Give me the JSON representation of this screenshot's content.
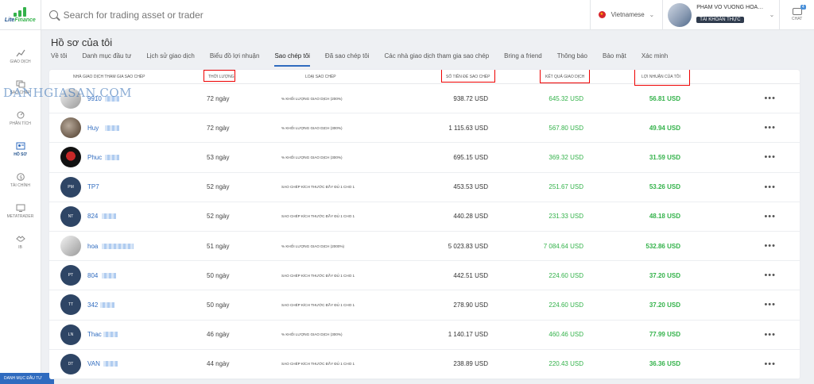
{
  "app": {
    "logo_text_1": "Lite",
    "logo_text_2": "Finance"
  },
  "search": {
    "placeholder": "Search for trading asset or trader"
  },
  "language": {
    "label": "Vietnamese"
  },
  "user": {
    "name": "PHAM VO VUONG HOA…",
    "account_type": "TÀI KHOẢN THỰC"
  },
  "chat": {
    "label": "CHAT",
    "count": "4"
  },
  "sidebar": {
    "items": [
      {
        "label": "GIAO DỊCH",
        "icon": "chart-line-icon"
      },
      {
        "label": "SAO CHÉP",
        "icon": "copy-icon"
      },
      {
        "label": "PHÂN TÍCH",
        "icon": "analytics-icon"
      },
      {
        "label": "HỒ SƠ",
        "icon": "profile-icon"
      },
      {
        "label": "TÀI CHÍNH",
        "icon": "dollar-icon"
      },
      {
        "label": "METATRADER",
        "icon": "monitor-icon"
      },
      {
        "label": "IB",
        "icon": "handshake-icon"
      }
    ],
    "bottom_label": "DANH MỤC ĐẦU TƯ",
    "active_index": 3
  },
  "page": {
    "title": "Hồ sơ của tôi"
  },
  "tabs": [
    "Về tôi",
    "Danh mục đầu tư",
    "Lịch sử giao dịch",
    "Biểu đồ lợi nhuận",
    "Sao chép tôi",
    "Đã sao chép tôi",
    "Các nhà giao dịch tham gia sao chép",
    "Bring a friend",
    "Thông báo",
    "Bảo mật",
    "Xác minh"
  ],
  "active_tab": 4,
  "table": {
    "headers": {
      "trader": "NHÀ GIAO DỊCH THAM GIA SAO CHÉP",
      "duration": "THỜI LƯỢNG",
      "copy_type": "LOẠI SAO CHÉP",
      "amount": "SỐ TIỀN ĐỂ SAO CHÉP",
      "result": "KẾT QUẢ GIAO DỊCH",
      "profit": "LỢI NHUẬN CỦA TÔI"
    },
    "rows": [
      {
        "avatar": "",
        "trader": "9910",
        "duration": "72 ngày",
        "copy_type": "% KHỐI LƯỢNG GIAO DỊCH (200%)",
        "amount": "938.72 USD",
        "result": "645.32 USD",
        "profit": "56.81 USD"
      },
      {
        "avatar": "",
        "trader": "Huy",
        "duration": "72 ngày",
        "copy_type": "% KHỐI LƯỢNG GIAO DỊCH (300%)",
        "amount": "1 115.63 USD",
        "result": "567.80 USD",
        "profit": "49.94 USD"
      },
      {
        "avatar": "",
        "trader": "Phuc",
        "duration": "53 ngày",
        "copy_type": "% KHỐI LƯỢNG GIAO DỊCH (300%)",
        "amount": "695.15 USD",
        "result": "369.32 USD",
        "profit": "31.59 USD"
      },
      {
        "avatar": "PM",
        "trader": "TP7",
        "duration": "52 ngày",
        "copy_type": "SAO CHÉP KÍCH THƯỚC ĐẦY ĐỦ 1 CHO 1",
        "amount": "453.53 USD",
        "result": "251.67 USD",
        "profit": "53.26 USD"
      },
      {
        "avatar": "NT",
        "trader": "824",
        "duration": "52 ngày",
        "copy_type": "SAO CHÉP KÍCH THƯỚC ĐẦY ĐỦ 1 CHO 1",
        "amount": "440.28 USD",
        "result": "231.33 USD",
        "profit": "48.18 USD"
      },
      {
        "avatar": "",
        "trader": "hoa",
        "duration": "51 ngày",
        "copy_type": "% KHỐI LƯỢNG GIAO DỊCH (2000%)",
        "amount": "5 023.83 USD",
        "result": "7 084.64 USD",
        "profit": "532.86 USD"
      },
      {
        "avatar": "PT",
        "trader": "804",
        "duration": "50 ngày",
        "copy_type": "SAO CHÉP KÍCH THƯỚC ĐẦY ĐỦ 1 CHO 1",
        "amount": "442.51 USD",
        "result": "224.60 USD",
        "profit": "37.20 USD"
      },
      {
        "avatar": "TT",
        "trader": "342",
        "duration": "50 ngày",
        "copy_type": "SAO CHÉP KÍCH THƯỚC ĐẦY ĐỦ 1 CHO 1",
        "amount": "278.90 USD",
        "result": "224.60 USD",
        "profit": "37.20 USD"
      },
      {
        "avatar": "LN",
        "trader": "Thac",
        "duration": "46 ngày",
        "copy_type": "% KHỐI LƯỢNG GIAO DỊCH (300%)",
        "amount": "1 140.17 USD",
        "result": "460.46 USD",
        "profit": "77.99 USD"
      },
      {
        "avatar": "DT",
        "trader": "VAN",
        "duration": "44 ngày",
        "copy_type": "SAO CHÉP KÍCH THƯỚC ĐẦY ĐỦ 1 CHO 1",
        "amount": "238.89 USD",
        "result": "220.43 USD",
        "profit": "36.36 USD"
      }
    ]
  },
  "watermark": "DANHGIASAN.COM",
  "colors": {
    "accent": "#2f6bbf",
    "positive": "#33b24a",
    "highlight": "#e00000"
  }
}
